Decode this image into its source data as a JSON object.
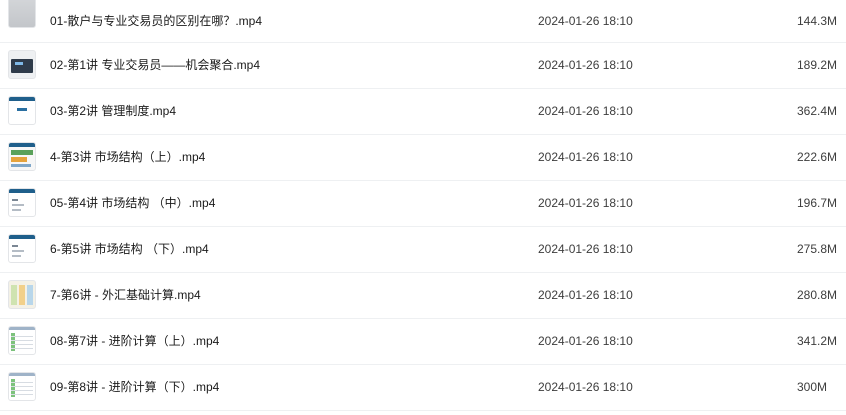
{
  "files": [
    {
      "name": "01-散户与专业交易员的区别在哪？.mp4",
      "date": "2024-01-26 18:10",
      "size": "144.3M",
      "thumb": "grey-thumbnail"
    },
    {
      "name": "02-第1讲 专业交易员——机会聚合.mp4",
      "date": "2024-01-26 18:10",
      "size": "189.2M",
      "thumb": "dark-slide-thumbnail"
    },
    {
      "name": "03-第2讲 管理制度.mp4",
      "date": "2024-01-26 18:10",
      "size": "362.4M",
      "thumb": "slide-thumbnail"
    },
    {
      "name": "4-第3讲 市场结构（上）.mp4",
      "date": "2024-01-26 18:10",
      "size": "222.6M",
      "thumb": "chart-thumbnail"
    },
    {
      "name": "05-第4讲 市场结构 （中）.mp4",
      "date": "2024-01-26 18:10",
      "size": "196.7M",
      "thumb": "text-slide-thumbnail"
    },
    {
      "name": "6-第5讲 市场结构 （下）.mp4",
      "date": "2024-01-26 18:10",
      "size": "275.8M",
      "thumb": "text-slide-thumbnail"
    },
    {
      "name": "7-第6讲 - 外汇基础计算.mp4",
      "date": "2024-01-26 18:10",
      "size": "280.8M",
      "thumb": "table-thumbnail"
    },
    {
      "name": "08-第7讲 - 进阶计算（上）.mp4",
      "date": "2024-01-26 18:10",
      "size": "341.2M",
      "thumb": "sheet-thumbnail"
    },
    {
      "name": "09-第8讲 - 进阶计算（下）.mp4",
      "date": "2024-01-26 18:10",
      "size": "300M",
      "thumb": "sheet-thumbnail"
    }
  ]
}
